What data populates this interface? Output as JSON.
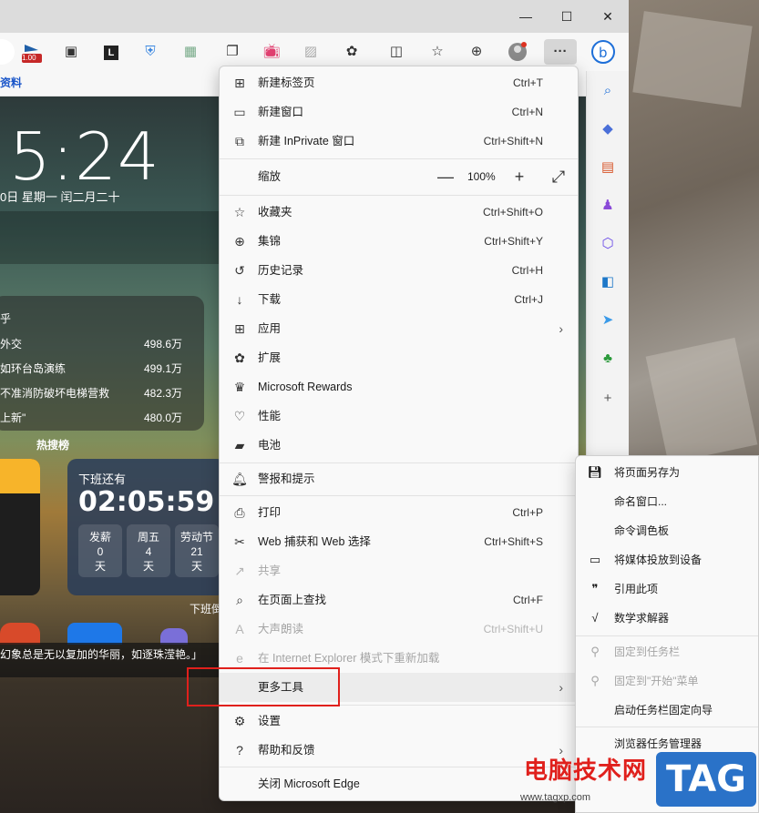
{
  "window": {
    "minimize": "—",
    "maximize": "☐",
    "close": "✕"
  },
  "toolbar": {
    "icons": [
      "badge-icon",
      "extension-icon",
      "l-icon",
      "shield-icon",
      "image-icon",
      "copy-icon",
      "tv-icon",
      "photo-icon",
      "puzzle-icon",
      "split-icon",
      "favorites-icon",
      "collections-icon",
      "profile-icon",
      "more-icon",
      "bing-icon"
    ],
    "badge_value": "1.00",
    "more_label": "···"
  },
  "bookmarks": {
    "item": "资料"
  },
  "newtab": {
    "clock": "5:24",
    "date": "0日  星期一  闰二月二十",
    "hot_card": {
      "title": "乎",
      "items": [
        {
          "text": "外交",
          "value": "498.6万"
        },
        {
          "text": "如环台岛演练",
          "value": "499.1万"
        },
        {
          "text": "不准消防破坏电梯营救",
          "value": "482.3万"
        },
        {
          "text": "上新\"",
          "value": "480.0万"
        }
      ],
      "footer": "热搜榜"
    },
    "timer": {
      "title": "下班还有",
      "time": "02:05:59",
      "counts": [
        {
          "label": "发薪",
          "num": "0",
          "unit": "天"
        },
        {
          "label": "周五",
          "num": "4",
          "unit": "天"
        },
        {
          "label": "劳动节",
          "num": "21",
          "unit": "天"
        }
      ],
      "footer": "下班倒"
    },
    "quote": "幻象总是无以复加的华丽，如逐珠滢艳。」"
  },
  "menu": {
    "items": [
      {
        "name": "menu-new-tab",
        "icon": "new-tab-icon",
        "glyph": "⊞",
        "label": "新建标签页",
        "shortcut": "Ctrl+T"
      },
      {
        "name": "menu-new-window",
        "icon": "new-window-icon",
        "glyph": "▭",
        "label": "新建窗口",
        "shortcut": "Ctrl+N"
      },
      {
        "name": "menu-inprivate",
        "icon": "inprivate-icon",
        "glyph": "⧉",
        "label": "新建 InPrivate 窗口",
        "shortcut": "Ctrl+Shift+N"
      },
      {
        "name": "menu-favorites",
        "icon": "favorites-icon",
        "glyph": "☆",
        "label": "收藏夹",
        "shortcut": "Ctrl+Shift+O"
      },
      {
        "name": "menu-collections",
        "icon": "collections-icon",
        "glyph": "⊕",
        "label": "集锦",
        "shortcut": "Ctrl+Shift+Y"
      },
      {
        "name": "menu-history",
        "icon": "history-icon",
        "glyph": "↺",
        "label": "历史记录",
        "shortcut": "Ctrl+H"
      },
      {
        "name": "menu-downloads",
        "icon": "download-icon",
        "glyph": "↓",
        "label": "下载",
        "shortcut": "Ctrl+J"
      },
      {
        "name": "menu-apps",
        "icon": "apps-icon",
        "glyph": "⊞",
        "label": "应用",
        "shortcut": ""
      },
      {
        "name": "menu-extensions",
        "icon": "extensions-icon",
        "glyph": "✿",
        "label": "扩展",
        "shortcut": ""
      },
      {
        "name": "menu-rewards",
        "icon": "rewards-icon",
        "glyph": "♛",
        "label": "Microsoft Rewards",
        "shortcut": ""
      },
      {
        "name": "menu-performance",
        "icon": "performance-icon",
        "glyph": "♡",
        "label": "性能",
        "shortcut": ""
      },
      {
        "name": "menu-battery",
        "icon": "battery-icon",
        "glyph": "▰",
        "label": "电池",
        "shortcut": ""
      },
      {
        "name": "menu-alerts",
        "icon": "bell-icon",
        "glyph": "🔔︎",
        "label": "警报和提示",
        "shortcut": ""
      },
      {
        "name": "menu-print",
        "icon": "print-icon",
        "glyph": "⎙",
        "label": "打印",
        "shortcut": "Ctrl+P"
      },
      {
        "name": "menu-web-capture",
        "icon": "capture-icon",
        "glyph": "✂",
        "label": "Web 捕获和 Web 选择",
        "shortcut": "Ctrl+Shift+S"
      },
      {
        "name": "menu-share",
        "icon": "share-icon",
        "glyph": "↗",
        "label": "共享",
        "shortcut": ""
      },
      {
        "name": "menu-find",
        "icon": "find-icon",
        "glyph": "⌕",
        "label": "在页面上查找",
        "shortcut": "Ctrl+F"
      },
      {
        "name": "menu-read-aloud",
        "icon": "read-aloud-icon",
        "glyph": "A",
        "label": "大声朗读",
        "shortcut": "Ctrl+Shift+U"
      },
      {
        "name": "menu-ie-mode",
        "icon": "ie-icon",
        "glyph": "e",
        "label": "在 Internet Explorer 模式下重新加载",
        "shortcut": ""
      },
      {
        "name": "menu-more-tools",
        "icon": "",
        "glyph": "",
        "label": "更多工具",
        "shortcut": ""
      },
      {
        "name": "menu-settings",
        "icon": "settings-icon",
        "glyph": "⚙",
        "label": "设置",
        "shortcut": ""
      },
      {
        "name": "menu-help",
        "icon": "help-icon",
        "glyph": "?",
        "label": "帮助和反馈",
        "shortcut": ""
      },
      {
        "name": "menu-close-edge",
        "icon": "",
        "glyph": "",
        "label": "关闭 Microsoft Edge",
        "shortcut": ""
      }
    ],
    "zoom": {
      "label": "缩放",
      "value": "100%",
      "minus": "—",
      "plus": "+",
      "fullscreen": "⤢"
    },
    "arrow": "›"
  },
  "submenu": {
    "items": [
      {
        "name": "sub-save-as",
        "icon": "save-icon",
        "glyph": "💾︎",
        "label": "将页面另存为",
        "disabled": false
      },
      {
        "name": "sub-name-window",
        "icon": "",
        "glyph": "",
        "label": "命名窗口...",
        "disabled": false
      },
      {
        "name": "sub-command-palette",
        "icon": "",
        "glyph": "",
        "label": "命令调色板",
        "disabled": false
      },
      {
        "name": "sub-cast",
        "icon": "cast-icon",
        "glyph": "▭",
        "label": "将媒体投放到设备",
        "disabled": false
      },
      {
        "name": "sub-cite",
        "icon": "quote-icon",
        "glyph": "❞",
        "label": "引用此项",
        "disabled": false
      },
      {
        "name": "sub-math",
        "icon": "math-icon",
        "glyph": "√",
        "label": "数学求解器",
        "disabled": false
      },
      {
        "name": "sub-pin-taskbar",
        "icon": "pin-icon",
        "glyph": "⚲",
        "label": "固定到任务栏",
        "disabled": true
      },
      {
        "name": "sub-pin-start",
        "icon": "pin-icon",
        "glyph": "⚲",
        "label": "固定到\"开始\"菜单",
        "disabled": true
      },
      {
        "name": "sub-taskbar-wizard",
        "icon": "",
        "glyph": "",
        "label": "启动任务栏固定向导",
        "disabled": false
      },
      {
        "name": "sub-task-manager",
        "icon": "",
        "glyph": "",
        "label": "浏览器任务管理器",
        "disabled": false
      }
    ]
  },
  "watermark": {
    "site": "电脑技术网",
    "url": "www.tagxp.com",
    "tag": "TAG"
  }
}
